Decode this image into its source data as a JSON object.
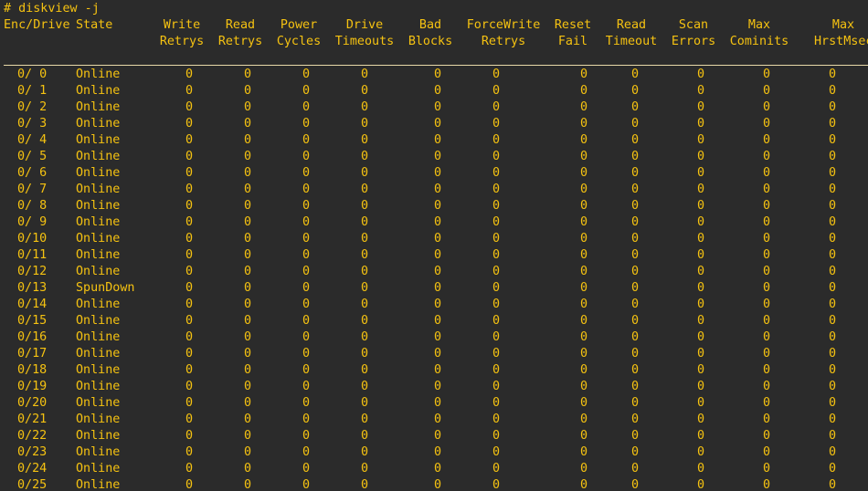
{
  "terminal": {
    "command": "# diskview -j",
    "headers": [
      {
        "key": "enc_drive",
        "line1": "Enc/Drive",
        "line2": ""
      },
      {
        "key": "state",
        "line1": "State",
        "line2": ""
      },
      {
        "key": "write_retrys",
        "line1": "Write",
        "line2": "Retrys"
      },
      {
        "key": "read_retrys",
        "line1": "Read",
        "line2": "Retrys"
      },
      {
        "key": "power_cycles",
        "line1": "Power",
        "line2": "Cycles"
      },
      {
        "key": "drive_timeouts",
        "line1": "Drive",
        "line2": "Timeouts"
      },
      {
        "key": "bad_blocks",
        "line1": "Bad",
        "line2": "Blocks"
      },
      {
        "key": "forcewrite_retrys",
        "line1": "ForceWrite",
        "line2": "Retrys"
      },
      {
        "key": "reset_fail",
        "line1": "Reset",
        "line2": "Fail"
      },
      {
        "key": "read_timeout",
        "line1": "Read",
        "line2": "Timeout"
      },
      {
        "key": "scan_errors",
        "line1": "Scan",
        "line2": "Errors"
      },
      {
        "key": "max_cominits",
        "line1": "Max",
        "line2": "Cominits"
      },
      {
        "key": "max_hrstmsecs",
        "line1": "Max",
        "line2": "HrstMsecs"
      }
    ],
    "rows": [
      {
        "drive": "0/ 0",
        "state": "Online",
        "values": [
          "0",
          "0",
          "0",
          "0",
          "0",
          "0",
          "0",
          "0",
          "0",
          "0",
          "0"
        ]
      },
      {
        "drive": "0/ 1",
        "state": "Online",
        "values": [
          "0",
          "0",
          "0",
          "0",
          "0",
          "0",
          "0",
          "0",
          "0",
          "0",
          "0"
        ]
      },
      {
        "drive": "0/ 2",
        "state": "Online",
        "values": [
          "0",
          "0",
          "0",
          "0",
          "0",
          "0",
          "0",
          "0",
          "0",
          "0",
          "0"
        ]
      },
      {
        "drive": "0/ 3",
        "state": "Online",
        "values": [
          "0",
          "0",
          "0",
          "0",
          "0",
          "0",
          "0",
          "0",
          "0",
          "0",
          "0"
        ]
      },
      {
        "drive": "0/ 4",
        "state": "Online",
        "values": [
          "0",
          "0",
          "0",
          "0",
          "0",
          "0",
          "0",
          "0",
          "0",
          "0",
          "0"
        ]
      },
      {
        "drive": "0/ 5",
        "state": "Online",
        "values": [
          "0",
          "0",
          "0",
          "0",
          "0",
          "0",
          "0",
          "0",
          "0",
          "0",
          "0"
        ]
      },
      {
        "drive": "0/ 6",
        "state": "Online",
        "values": [
          "0",
          "0",
          "0",
          "0",
          "0",
          "0",
          "0",
          "0",
          "0",
          "0",
          "0"
        ]
      },
      {
        "drive": "0/ 7",
        "state": "Online",
        "values": [
          "0",
          "0",
          "0",
          "0",
          "0",
          "0",
          "0",
          "0",
          "0",
          "0",
          "0"
        ]
      },
      {
        "drive": "0/ 8",
        "state": "Online",
        "values": [
          "0",
          "0",
          "0",
          "0",
          "0",
          "0",
          "0",
          "0",
          "0",
          "0",
          "0"
        ]
      },
      {
        "drive": "0/ 9",
        "state": "Online",
        "values": [
          "0",
          "0",
          "0",
          "0",
          "0",
          "0",
          "0",
          "0",
          "0",
          "0",
          "0"
        ]
      },
      {
        "drive": "0/10",
        "state": "Online",
        "values": [
          "0",
          "0",
          "0",
          "0",
          "0",
          "0",
          "0",
          "0",
          "0",
          "0",
          "0"
        ]
      },
      {
        "drive": "0/11",
        "state": "Online",
        "values": [
          "0",
          "0",
          "0",
          "0",
          "0",
          "0",
          "0",
          "0",
          "0",
          "0",
          "0"
        ]
      },
      {
        "drive": "0/12",
        "state": "Online",
        "values": [
          "0",
          "0",
          "0",
          "0",
          "0",
          "0",
          "0",
          "0",
          "0",
          "0",
          "0"
        ]
      },
      {
        "drive": "0/13",
        "state": "SpunDown",
        "values": [
          "0",
          "0",
          "0",
          "0",
          "0",
          "0",
          "0",
          "0",
          "0",
          "0",
          "0"
        ]
      },
      {
        "drive": "0/14",
        "state": "Online",
        "values": [
          "0",
          "0",
          "0",
          "0",
          "0",
          "0",
          "0",
          "0",
          "0",
          "0",
          "0"
        ]
      },
      {
        "drive": "0/15",
        "state": "Online",
        "values": [
          "0",
          "0",
          "0",
          "0",
          "0",
          "0",
          "0",
          "0",
          "0",
          "0",
          "0"
        ]
      },
      {
        "drive": "0/16",
        "state": "Online",
        "values": [
          "0",
          "0",
          "0",
          "0",
          "0",
          "0",
          "0",
          "0",
          "0",
          "0",
          "0"
        ]
      },
      {
        "drive": "0/17",
        "state": "Online",
        "values": [
          "0",
          "0",
          "0",
          "0",
          "0",
          "0",
          "0",
          "0",
          "0",
          "0",
          "0"
        ]
      },
      {
        "drive": "0/18",
        "state": "Online",
        "values": [
          "0",
          "0",
          "0",
          "0",
          "0",
          "0",
          "0",
          "0",
          "0",
          "0",
          "0"
        ]
      },
      {
        "drive": "0/19",
        "state": "Online",
        "values": [
          "0",
          "0",
          "0",
          "0",
          "0",
          "0",
          "0",
          "0",
          "0",
          "0",
          "0"
        ]
      },
      {
        "drive": "0/20",
        "state": "Online",
        "values": [
          "0",
          "0",
          "0",
          "0",
          "0",
          "0",
          "0",
          "0",
          "0",
          "0",
          "0"
        ]
      },
      {
        "drive": "0/21",
        "state": "Online",
        "values": [
          "0",
          "0",
          "0",
          "0",
          "0",
          "0",
          "0",
          "0",
          "0",
          "0",
          "0"
        ]
      },
      {
        "drive": "0/22",
        "state": "Online",
        "values": [
          "0",
          "0",
          "0",
          "0",
          "0",
          "0",
          "0",
          "0",
          "0",
          "0",
          "0"
        ]
      },
      {
        "drive": "0/23",
        "state": "Online",
        "values": [
          "0",
          "0",
          "0",
          "0",
          "0",
          "0",
          "0",
          "0",
          "0",
          "0",
          "0"
        ]
      },
      {
        "drive": "0/24",
        "state": "Online",
        "values": [
          "0",
          "0",
          "0",
          "0",
          "0",
          "0",
          "0",
          "0",
          "0",
          "0",
          "0"
        ]
      },
      {
        "drive": "0/25",
        "state": "Online",
        "values": [
          "0",
          "0",
          "0",
          "0",
          "0",
          "0",
          "0",
          "0",
          "0",
          "0",
          "0"
        ]
      }
    ]
  },
  "colors": {
    "background": "#2b2b2b",
    "text": "#f5c211",
    "separator": "#e8d9a8"
  }
}
